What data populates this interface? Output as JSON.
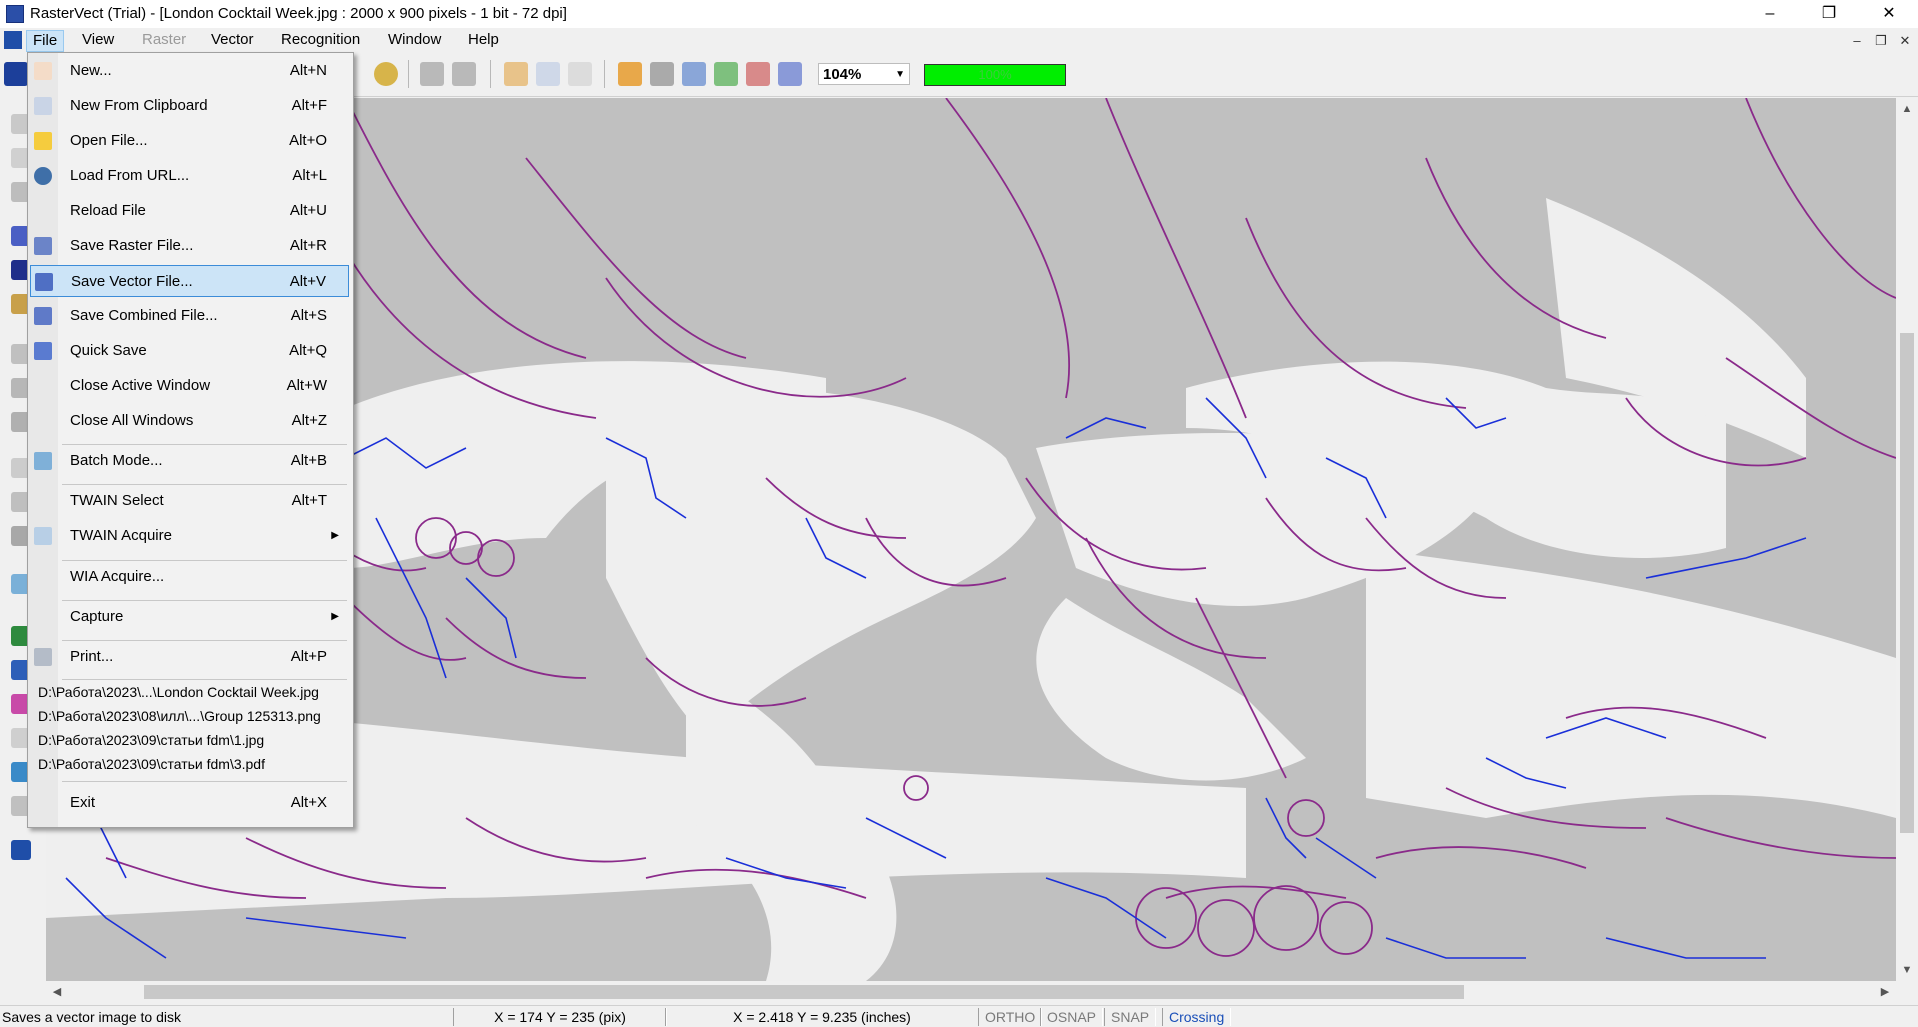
{
  "window": {
    "title": "RasterVect (Trial) - [London Cocktail Week.jpg : 2000 x 900 pixels - 1 bit - 72 dpi]",
    "controls": {
      "minimize": "–",
      "restore": "❐",
      "close": "✕"
    }
  },
  "menubar": {
    "items": [
      {
        "label": "File",
        "state": "active"
      },
      {
        "label": "View",
        "state": "normal"
      },
      {
        "label": "Raster",
        "state": "disabled"
      },
      {
        "label": "Vector",
        "state": "normal"
      },
      {
        "label": "Recognition",
        "state": "normal"
      },
      {
        "label": "Window",
        "state": "normal"
      },
      {
        "label": "Help",
        "state": "normal"
      }
    ],
    "mdi_controls": {
      "minimize": "–",
      "restore": "❐",
      "close": "✕"
    }
  },
  "toolbar": {
    "zoom": "104%",
    "progress_label": "100%",
    "progress_value": 1.0,
    "progress_color": "#00ee00"
  },
  "file_menu": {
    "items": [
      {
        "label": "New...",
        "shortcut": "Alt+N",
        "icon": "new-file-icon"
      },
      {
        "label": "New From Clipboard",
        "shortcut": "Alt+F",
        "icon": "clipboard-icon"
      },
      {
        "label": "Open File...",
        "shortcut": "Alt+O",
        "icon": "folder-icon"
      },
      {
        "label": "Load From URL...",
        "shortcut": "Alt+L",
        "icon": "globe-icon"
      },
      {
        "label": "Reload File",
        "shortcut": "Alt+U",
        "icon": ""
      },
      {
        "label": "Save Raster File...",
        "shortcut": "Alt+R",
        "icon": "save-raster-icon"
      },
      {
        "label": "Save Vector File...",
        "shortcut": "Alt+V",
        "icon": "save-vector-icon",
        "highlighted": true
      },
      {
        "label": "Save Combined File...",
        "shortcut": "Alt+S",
        "icon": "save-combined-icon"
      },
      {
        "label": "Quick Save",
        "shortcut": "Alt+Q",
        "icon": "quick-save-icon"
      },
      {
        "label": "Close Active Window",
        "shortcut": "Alt+W",
        "icon": ""
      },
      {
        "label": "Close All Windows",
        "shortcut": "Alt+Z",
        "icon": ""
      },
      {
        "label": "Batch Mode...",
        "shortcut": "Alt+B",
        "icon": "batch-icon"
      },
      {
        "label": "TWAIN Select",
        "shortcut": "Alt+T",
        "icon": ""
      },
      {
        "label": "TWAIN Acquire",
        "shortcut": "",
        "icon": "scanner-icon",
        "submenu": true
      },
      {
        "label": "WIA Acquire...",
        "shortcut": "",
        "icon": ""
      },
      {
        "label": "Capture",
        "shortcut": "",
        "icon": "",
        "submenu": true
      },
      {
        "label": "Print...",
        "shortcut": "Alt+P",
        "icon": "printer-icon"
      },
      {
        "label": "Exit",
        "shortcut": "Alt+X",
        "icon": ""
      }
    ],
    "recent_files": [
      "D:\\Работа\\2023\\...\\London Cocktail Week.jpg",
      "D:\\Работа\\2023\\08\\илл\\...\\Group 125313.png",
      "D:\\Работа\\2023\\09\\статьи fdm\\1.jpg",
      "D:\\Работа\\2023\\09\\статьи fdm\\3.pdf"
    ]
  },
  "statusbar": {
    "message": "Saves a vector image to disk",
    "pixel_coords": "X = 174   Y = 235 (pix)",
    "inch_coords": "X = 2.418   Y = 9.235 (inches)",
    "flags": [
      {
        "label": "ORTHO",
        "active": false
      },
      {
        "label": "OSNAP",
        "active": false
      },
      {
        "label": "SNAP",
        "active": false
      },
      {
        "label": "Crossing",
        "active": true
      }
    ]
  },
  "colors": {
    "canvas_gray": "#c0c0c0",
    "canvas_white": "#efefef",
    "vector_purple": "#8a2a8a",
    "vector_blue": "#1a2fd8",
    "highlight": "#cce4f7"
  }
}
